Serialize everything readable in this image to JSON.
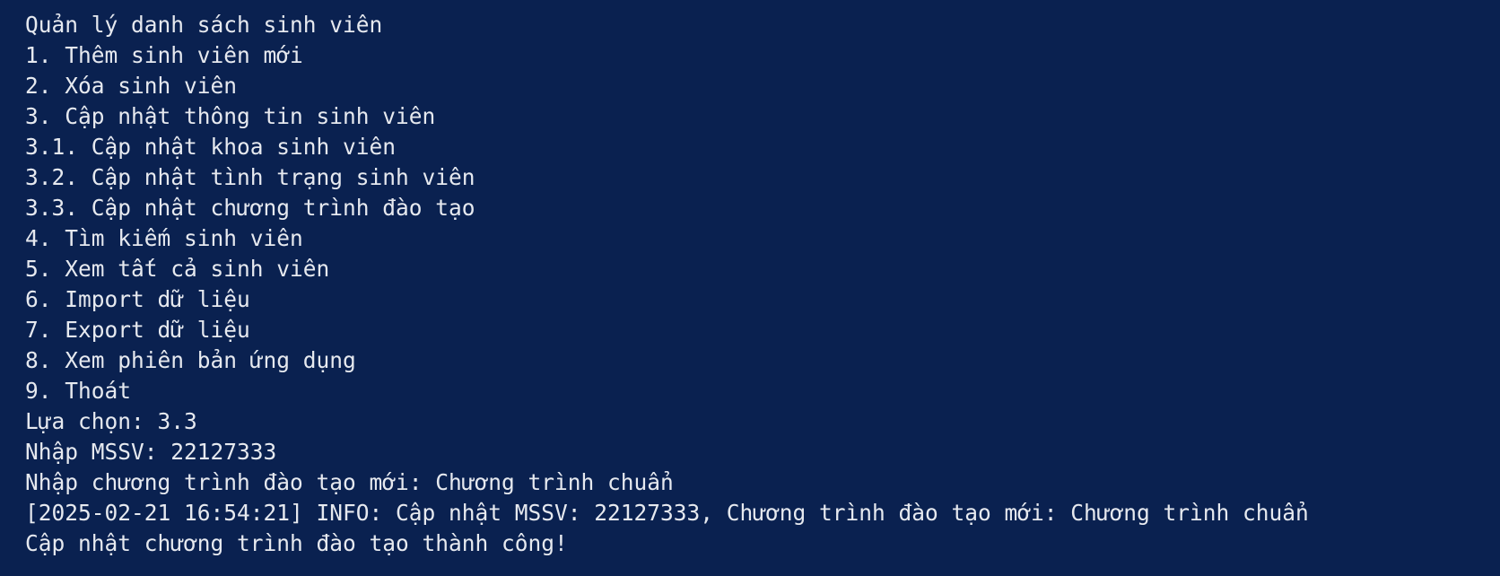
{
  "terminal": {
    "colors": {
      "background": "#0a2150",
      "foreground": "#e6e9ef"
    },
    "lines": [
      "Quản lý danh sách sinh viên",
      "1. Thêm sinh viên mới",
      "2. Xóa sinh viên",
      "3. Cập nhật thông tin sinh viên",
      "3.1. Cập nhật khoa sinh viên",
      "3.2. Cập nhật tình trạng sinh viên",
      "3.3. Cập nhật chương trình đào tạo",
      "4. Tìm kiếm sinh viên",
      "5. Xem tất cả sinh viên",
      "6. Import dữ liệu",
      "7. Export dữ liệu",
      "8. Xem phiên bản ứng dụng",
      "9. Thoát",
      "Lựa chọn: 3.3",
      "Nhập MSSV: 22127333",
      "Nhập chương trình đào tạo mới: Chương trình chuẩn",
      "[2025-02-21 16:54:21] INFO: Cập nhật MSSV: 22127333, Chương trình đào tạo mới: Chương trình chuẩn",
      "Cập nhật chương trình đào tạo thành công!"
    ]
  }
}
